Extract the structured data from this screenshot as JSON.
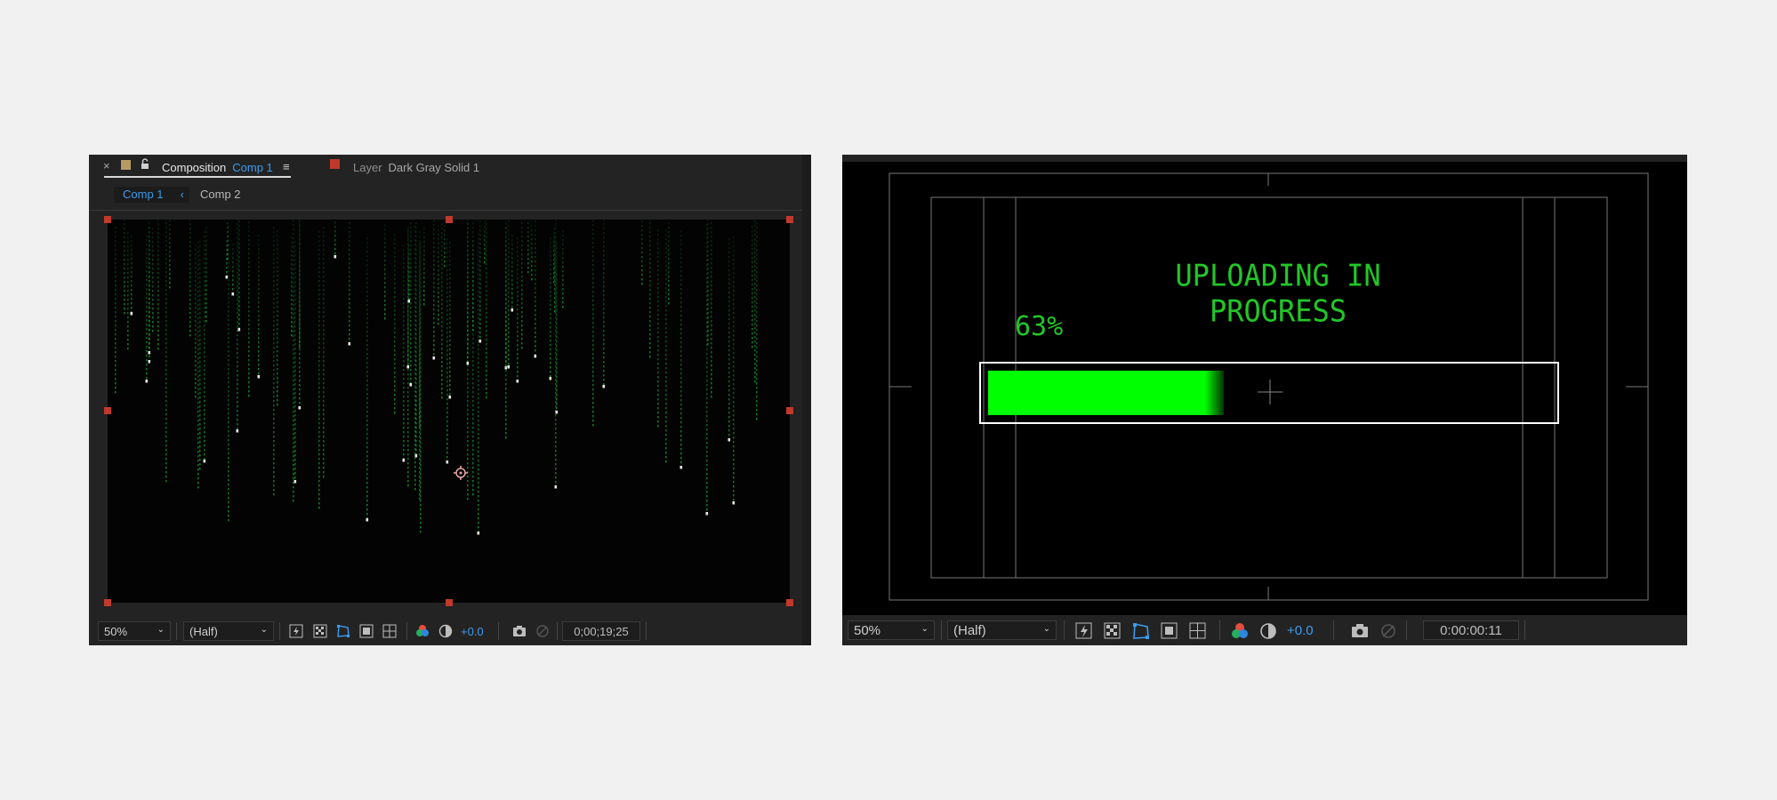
{
  "left_panel": {
    "close_glyph": "×",
    "tab_composition_label": "Composition",
    "tab_composition_name": "Comp 1",
    "menu_glyph": "≡",
    "tab_layer_label": "Layer",
    "tab_layer_name": "Dark Gray Solid 1",
    "breadcrumbs": [
      "Comp 1",
      "Comp 2"
    ],
    "breadcrumb_arrow": "‹",
    "toolbar": {
      "zoom": "50%",
      "resolution": "(Half)",
      "exposure": "+0.0",
      "timecode": "0;00;19;25"
    },
    "colors": {
      "accent": "#3b9cf0",
      "rain": "#1fae3a",
      "handle": "#c0392b"
    }
  },
  "right_panel": {
    "title_text": "UPLOADING IN PROGRESS",
    "percent_text": "63%",
    "progress_fraction": 0.42,
    "toolbar": {
      "zoom": "50%",
      "resolution": "(Half)",
      "exposure": "+0.0",
      "timecode": "0:00:00:11"
    },
    "colors": {
      "progress": "#00ff00",
      "text": "#22c628",
      "guides": "#777777"
    }
  },
  "icons": [
    "lightning-icon",
    "checkerboard-icon",
    "mask-icon",
    "region-icon",
    "grid-icon",
    "color-channels-icon",
    "exposure-icon",
    "camera-icon",
    "snapshot-icon"
  ]
}
